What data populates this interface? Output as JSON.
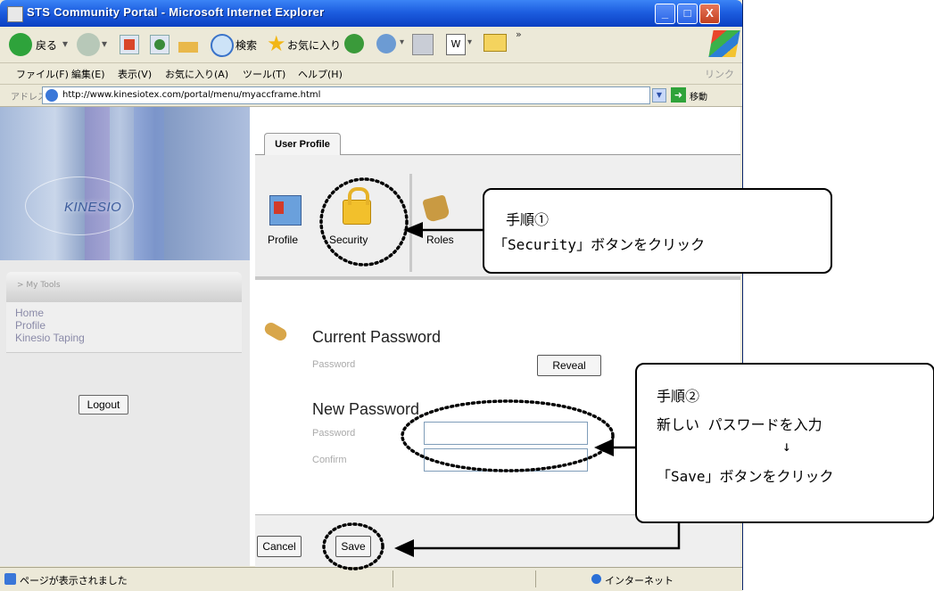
{
  "window": {
    "title": "STS Community Portal - Microsoft Internet Explorer",
    "minimize": "_",
    "maximize": "□",
    "close": "X"
  },
  "toolbar": {
    "back_label": "戻る",
    "search_label": "検索",
    "favorites_label": "お気に入り"
  },
  "menu": [
    "ファイル(F)",
    "編集(E)",
    "表示(V)",
    "お気に入り(A)",
    "ツール(T)",
    "ヘルプ(H)"
  ],
  "links_label": "リンク",
  "address": {
    "label": "アドレス(D)",
    "url": "http://www.kinesiotex.com/portal/menu/myaccframe.html",
    "go_label": "移動"
  },
  "sidebar": {
    "logo": "KINESIO",
    "header": "> My Tools",
    "links": [
      "Home",
      "Profile",
      "Kinesio Taping"
    ],
    "logout": "Logout"
  },
  "tabs": {
    "active": "User Profile"
  },
  "tools": [
    "Profile",
    "Security",
    "Roles"
  ],
  "current_password": {
    "heading": "Current Password",
    "label": "Password",
    "reveal": "Reveal"
  },
  "new_password": {
    "heading": "New Password",
    "password_label": "Password",
    "confirm_label": "Confirm",
    "password_value": "",
    "confirm_value": ""
  },
  "actions": {
    "cancel": "Cancel",
    "save": "Save"
  },
  "status": {
    "text": "ページが表示されました",
    "zone": "インターネット"
  },
  "callouts": {
    "step1": {
      "line1": "手順①",
      "line2": "「Security」ボタンをクリック"
    },
    "step2": {
      "line1": "手順②",
      "line2": "新しい パスワードを入力",
      "arrow": "↓",
      "line3": "「Save」ボタンをクリック"
    }
  }
}
